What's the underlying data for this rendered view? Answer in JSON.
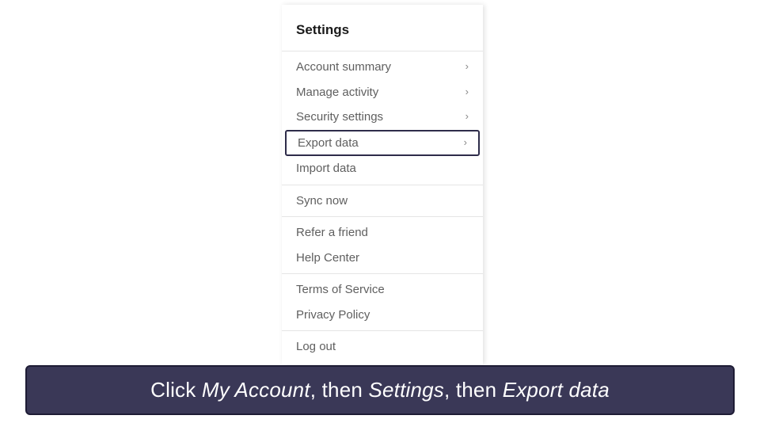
{
  "panel": {
    "title": "Settings",
    "group1": {
      "account_summary": "Account summary",
      "manage_activity": "Manage activity",
      "security_settings": "Security settings",
      "export_data": "Export data",
      "import_data": "Import data"
    },
    "group2": {
      "sync_now": "Sync now"
    },
    "group3": {
      "refer_friend": "Refer a friend",
      "help_center": "Help Center"
    },
    "group4": {
      "terms": "Terms of Service",
      "privacy": "Privacy Policy"
    },
    "group5": {
      "log_out": "Log out"
    }
  },
  "instruction": {
    "p1": "Click ",
    "e1": "My Account",
    "p2": ", then ",
    "e2": "Settings",
    "p3": ", then ",
    "e3": "Export data"
  },
  "chevron": "›"
}
